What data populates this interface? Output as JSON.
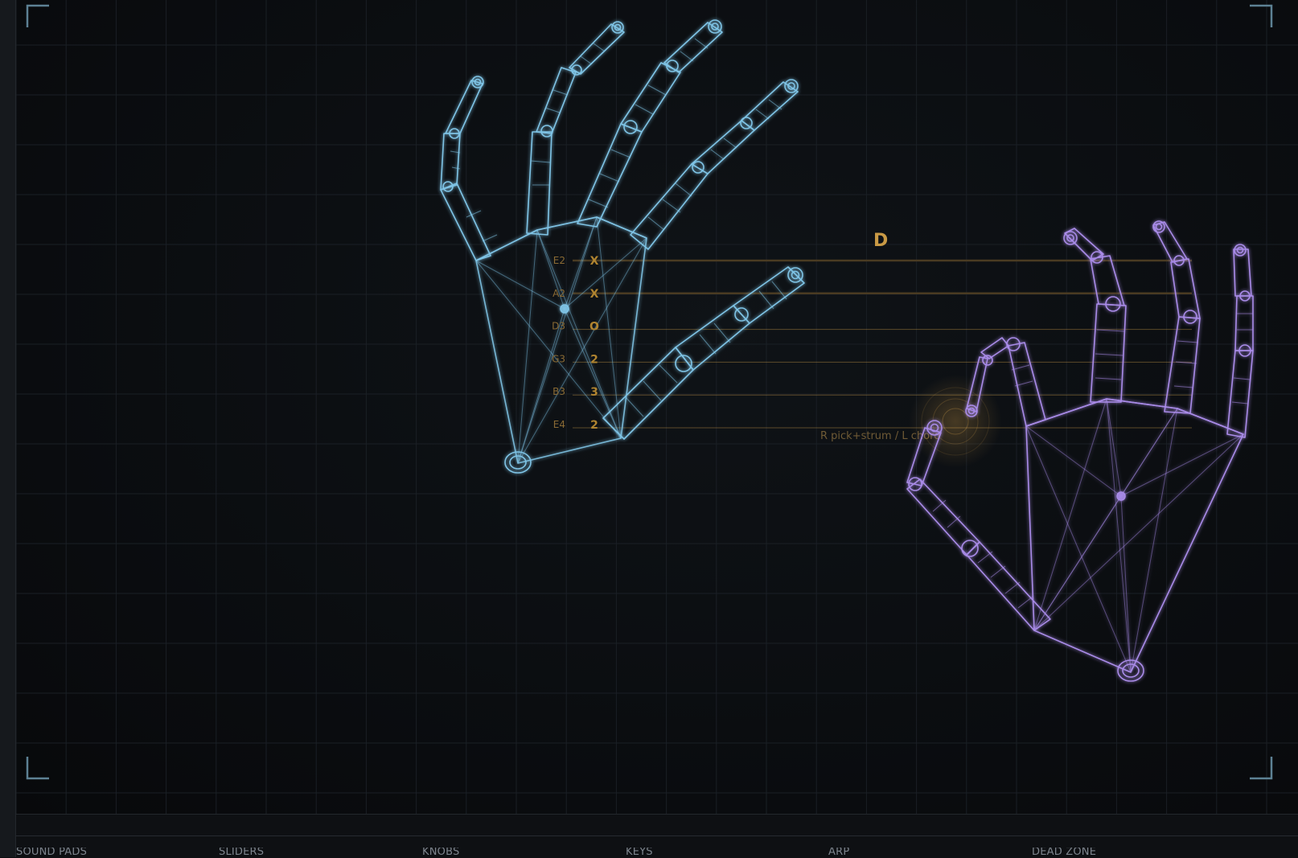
{
  "chord": {
    "name": "D",
    "hint": "R pick+strum / L chord"
  },
  "strings": [
    {
      "note": "E2",
      "fret": "X",
      "active": false
    },
    {
      "note": "A2",
      "fret": "X",
      "active": false
    },
    {
      "note": "D3",
      "fret": "O",
      "active": true
    },
    {
      "note": "G3",
      "fret": "2",
      "active": true
    },
    {
      "note": "B3",
      "fret": "3",
      "active": true
    },
    {
      "note": "E4",
      "fret": "2",
      "active": true
    }
  ],
  "tabs": [
    "SOUND PADS",
    "SLIDERS",
    "KNOBS",
    "KEYS",
    "ARP",
    "DEAD ZONE"
  ],
  "colors": {
    "left_hand": "#7fc4e6",
    "right_hand": "#a98be8",
    "string_active": "#f2b652",
    "string_inactive": "#4a3b22",
    "grid": "#1a1f25",
    "corner_bracket": "#5d8194"
  },
  "icons": [
    "corner-bracket-icon",
    "left-hand-wireframe",
    "right-hand-wireframe"
  ]
}
